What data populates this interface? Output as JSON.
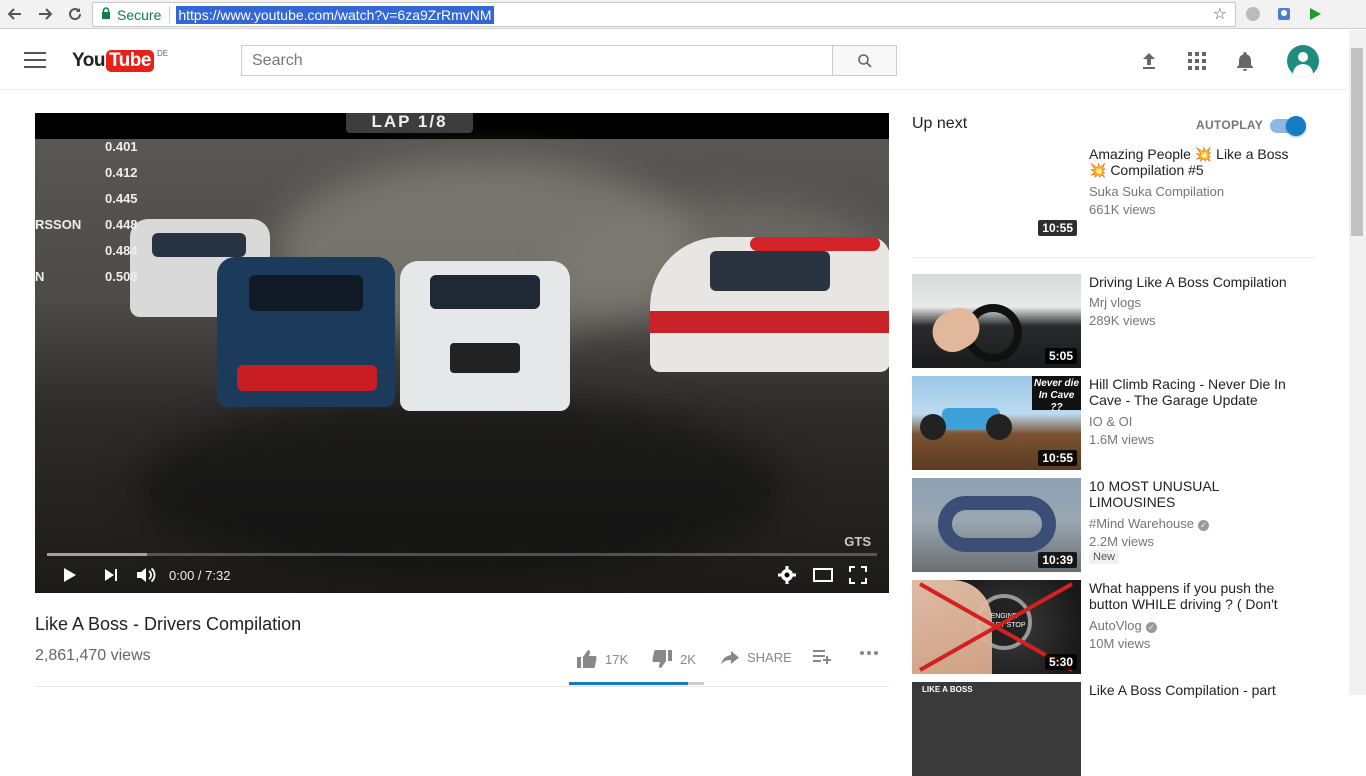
{
  "browser": {
    "secure_label": "Secure",
    "url": "https://www.youtube.com/watch?v=6za9ZrRmvNM"
  },
  "header": {
    "logo_you": "You",
    "logo_tube": "Tube",
    "region": "DE",
    "search_placeholder": "Search"
  },
  "player": {
    "lap_text": "LAP 1/8",
    "timing_values": [
      "0.401",
      "0.412",
      "0.445",
      "0.448",
      "0.484",
      "0.508"
    ],
    "timing_name": "RSSON",
    "timing_name_short": "N",
    "watermark": "GTS",
    "time_display": "0:00 / 7:32",
    "progress_loaded": 0.12
  },
  "video": {
    "title": "Like A Boss - Drivers Compilation",
    "views": "2,861,470 views",
    "likes": "17K",
    "dislikes": "2K",
    "share_label": "SHARE",
    "like_ratio": 0.88
  },
  "sidebar": {
    "up_next_label": "Up next",
    "autoplay_label": "AUTOPLAY",
    "autoplay_on": true,
    "items": [
      {
        "title": "Amazing People 💥 Like a Boss 💥 Compilation #5",
        "channel": "Suka Suka Compilation",
        "views": "661K views",
        "duration": "10:55",
        "verified": false,
        "new": false
      },
      {
        "title": "Driving Like A Boss Compilation",
        "channel": "Mrj vlogs",
        "views": "289K views",
        "duration": "5:05",
        "verified": false,
        "new": false
      },
      {
        "title": "Hill Climb Racing - Never Die In Cave - The Garage Update",
        "channel": "IO & OI",
        "views": "1.6M views",
        "duration": "10:55",
        "verified": false,
        "new": false,
        "thumb_text": "Never die In Cave ??"
      },
      {
        "title": "10 MOST UNUSUAL LIMOUSINES",
        "channel": "#Mind Warehouse",
        "views": "2.2M views",
        "duration": "10:39",
        "verified": true,
        "new": true,
        "new_label": "New"
      },
      {
        "title": "What happens if you push the button WHILE driving ? ( Don't",
        "channel": "AutoVlog",
        "views": "10M views",
        "duration": "5:30",
        "verified": true,
        "new": false,
        "thumb_text": "ENGINE START STOP"
      },
      {
        "title": "Like A Boss Compilation - part",
        "channel": "",
        "views": "",
        "duration": "",
        "verified": false,
        "new": false,
        "thumb_text": "LIKE A BOSS"
      }
    ]
  },
  "colors": {
    "youtube_red": "#e62117",
    "accent_blue": "#167ac6",
    "secure_green": "#0b8043"
  }
}
